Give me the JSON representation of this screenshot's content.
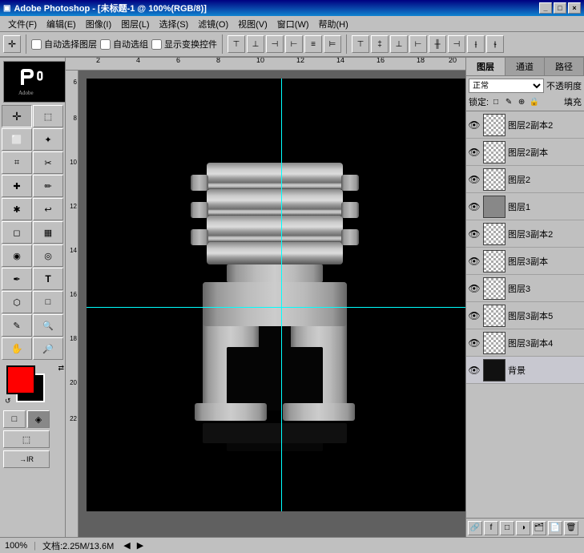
{
  "titleBar": {
    "title": "Adobe Photoshop - [未标题-1 @ 100%(RGB/8)]",
    "controls": [
      "_",
      "□",
      "×"
    ]
  },
  "menuBar": {
    "items": [
      "文件(F)",
      "编辑(E)",
      "图像(I)",
      "图层(L)",
      "选择(S)",
      "滤镜(O)",
      "视图(V)",
      "窗口(W)",
      "帮助(H)"
    ]
  },
  "toolbar": {
    "autoSelectLayer": "自动选择图层",
    "autoSelectGroup": "自动选组",
    "showTransformControls": "显示变换控件"
  },
  "layers": {
    "tabs": [
      "图层",
      "通道",
      "路径"
    ],
    "blendMode": "正常",
    "opacity": "不透明度",
    "lockLabel": "锁定:",
    "fillLabel": "填充",
    "items": [
      {
        "name": "图层2副本2",
        "visible": true,
        "type": "checker"
      },
      {
        "name": "图层2副本",
        "visible": true,
        "type": "checker"
      },
      {
        "name": "图层2",
        "visible": true,
        "type": "checker"
      },
      {
        "name": "图层1",
        "visible": true,
        "type": "checker"
      },
      {
        "name": "图层3副本2",
        "visible": true,
        "type": "checker"
      },
      {
        "name": "图层3副本",
        "visible": true,
        "type": "checker"
      },
      {
        "name": "图层3",
        "visible": true,
        "type": "checker"
      },
      {
        "name": "图层3副本5",
        "visible": true,
        "type": "checker"
      },
      {
        "name": "图层3副本4",
        "visible": true,
        "type": "checker"
      },
      {
        "name": "背景",
        "visible": true,
        "type": "black"
      }
    ]
  },
  "statusBar": {
    "zoom": "100%",
    "docInfo": "文档:2.25M/13.6M"
  },
  "canvas": {
    "rulerUnit": "cm"
  }
}
